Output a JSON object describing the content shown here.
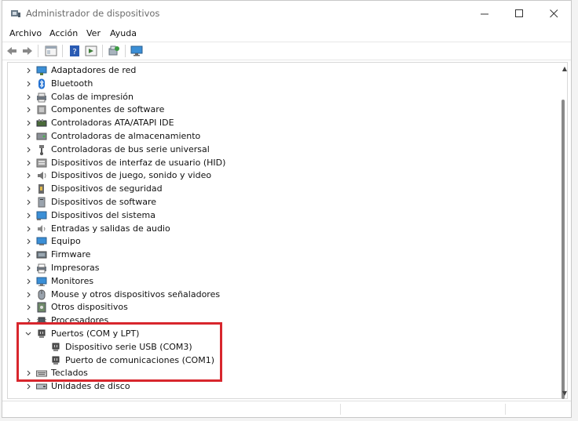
{
  "window": {
    "title": "Administrador de dispositivos",
    "controls": [
      "minimize-icon",
      "maximize-icon",
      "close-icon"
    ]
  },
  "menu": {
    "items": [
      "Archivo",
      "Acción",
      "Ver",
      "Ayuda"
    ]
  },
  "toolbar": {
    "icons": [
      "back-arrow-icon",
      "forward-arrow-icon",
      "properties-pane-icon",
      "help-icon",
      "properties-icon",
      "scan-hardware-icon",
      "monitor-icon"
    ]
  },
  "tree": {
    "items": [
      {
        "label": "Adaptadores de red",
        "icon": "network-adapter-icon",
        "expanded": false,
        "level": 0
      },
      {
        "label": "Bluetooth",
        "icon": "bluetooth-icon",
        "expanded": false,
        "level": 0
      },
      {
        "label": "Colas de impresión",
        "icon": "print-queue-icon",
        "expanded": false,
        "level": 0
      },
      {
        "label": "Componentes de software",
        "icon": "software-component-icon",
        "expanded": false,
        "level": 0
      },
      {
        "label": "Controladoras ATA/ATAPI IDE",
        "icon": "ata-controller-icon",
        "expanded": false,
        "level": 0
      },
      {
        "label": "Controladoras de almacenamiento",
        "icon": "storage-controller-icon",
        "expanded": false,
        "level": 0
      },
      {
        "label": "Controladoras de bus serie universal",
        "icon": "usb-controller-icon",
        "expanded": false,
        "level": 0
      },
      {
        "label": "Dispositivos de interfaz de usuario (HID)",
        "icon": "hid-icon",
        "expanded": false,
        "level": 0
      },
      {
        "label": "Dispositivos de juego, sonido y video",
        "icon": "sound-icon",
        "expanded": false,
        "level": 0
      },
      {
        "label": "Dispositivos de seguridad",
        "icon": "security-device-icon",
        "expanded": false,
        "level": 0
      },
      {
        "label": "Dispositivos de software",
        "icon": "software-device-icon",
        "expanded": false,
        "level": 0
      },
      {
        "label": "Dispositivos del sistema",
        "icon": "system-device-icon",
        "expanded": false,
        "level": 0
      },
      {
        "label": "Entradas y salidas de audio",
        "icon": "audio-io-icon",
        "expanded": false,
        "level": 0
      },
      {
        "label": "Equipo",
        "icon": "computer-icon",
        "expanded": false,
        "level": 0
      },
      {
        "label": "Firmware",
        "icon": "firmware-icon",
        "expanded": false,
        "level": 0
      },
      {
        "label": "Impresoras",
        "icon": "printer-icon",
        "expanded": false,
        "level": 0
      },
      {
        "label": "Monitores",
        "icon": "monitor-icon",
        "expanded": false,
        "level": 0
      },
      {
        "label": "Mouse y otros dispositivos señaladores",
        "icon": "mouse-icon",
        "expanded": false,
        "level": 0
      },
      {
        "label": "Otros dispositivos",
        "icon": "unknown-device-icon",
        "expanded": false,
        "level": 0
      },
      {
        "label": "Procesadores",
        "icon": "processor-icon",
        "expanded": false,
        "level": 0
      },
      {
        "label": "Puertos (COM y LPT)",
        "icon": "port-icon",
        "expanded": true,
        "level": 0
      },
      {
        "label": "Dispositivo serie USB (COM3)",
        "icon": "port-icon",
        "expanded": null,
        "level": 1
      },
      {
        "label": "Puerto de comunicaciones (COM1)",
        "icon": "port-icon",
        "expanded": null,
        "level": 1
      },
      {
        "label": "Teclados",
        "icon": "keyboard-icon",
        "expanded": false,
        "level": 0
      },
      {
        "label": "Unidades de disco",
        "icon": "disk-drive-icon",
        "expanded": false,
        "level": 0
      }
    ]
  },
  "colors": {
    "highlight_border": "#d8262d",
    "scrollbar_thumb": "#8a8a8a"
  }
}
